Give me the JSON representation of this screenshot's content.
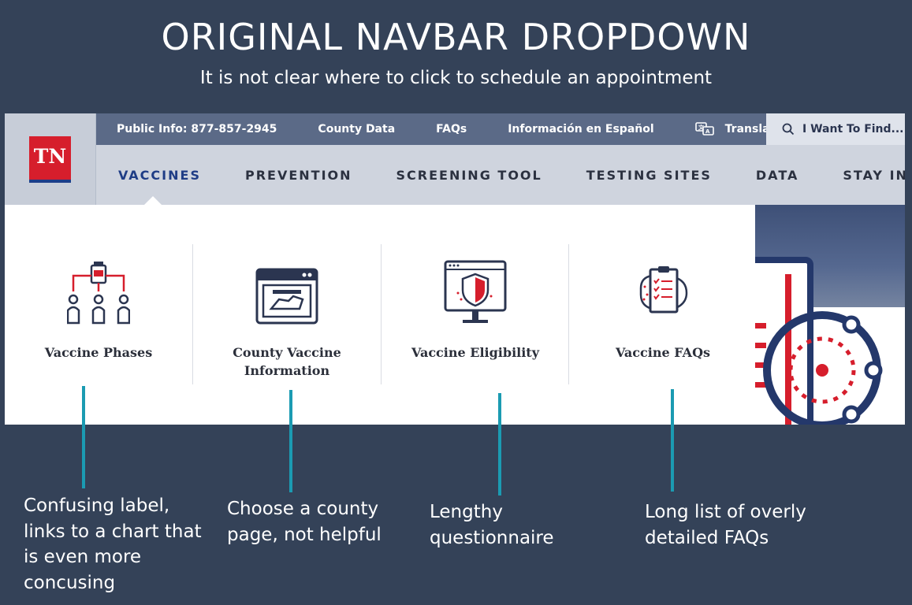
{
  "header": {
    "title": "ORIGINAL NAVBAR DROPDOWN",
    "subtitle": "It is not clear where to click to schedule an appointment"
  },
  "logo": {
    "text": "TN"
  },
  "topbar": {
    "links": [
      "Public Info: 877-857-2945",
      "County Data",
      "FAQs",
      "Información en Español",
      "Translate"
    ],
    "search_label": "I Want To Find..."
  },
  "mainnav": {
    "items": [
      "VACCINES",
      "PREVENTION",
      "SCREENING TOOL",
      "TESTING SITES",
      "DATA",
      "STAY INFORMED"
    ],
    "active": "VACCINES"
  },
  "dropdown": {
    "cards": [
      {
        "label": "Vaccine Phases",
        "icon": "vaccine-phases-icon"
      },
      {
        "label": "County Vaccine Information",
        "icon": "county-vaccine-info-icon"
      },
      {
        "label": "Vaccine Eligibility",
        "icon": "vaccine-eligibility-icon"
      },
      {
        "label": "Vaccine FAQs",
        "icon": "vaccine-faqs-icon"
      }
    ]
  },
  "annotations": [
    "Confusing label, links to a chart that is even more concusing",
    "Choose a county page, not helpful",
    "Lengthy questionnaire",
    "Long list of overly detailed  FAQs"
  ],
  "colors": {
    "background": "#344258",
    "pointer": "#1b9bb2",
    "brand_red": "#d61e2c",
    "brand_blue": "#1f3d86"
  }
}
